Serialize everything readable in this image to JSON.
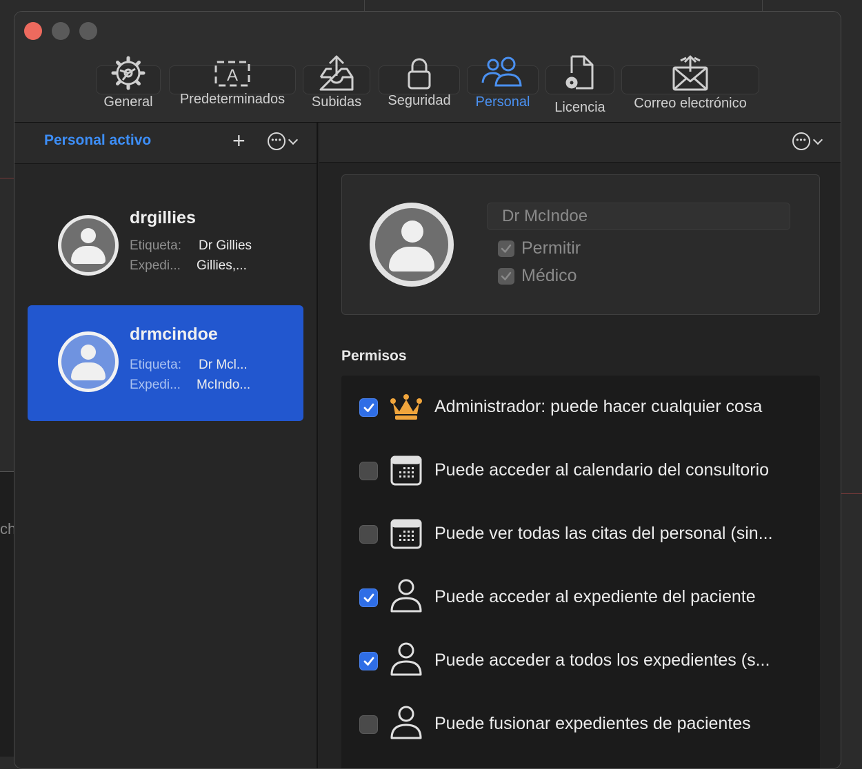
{
  "toolbar": {
    "items": [
      {
        "label": "General",
        "icon": "gear-icon"
      },
      {
        "label": "Predeterminados",
        "icon": "text-template-icon"
      },
      {
        "label": "Subidas",
        "icon": "upload-tray-icon"
      },
      {
        "label": "Seguridad",
        "icon": "lock-icon"
      },
      {
        "label": "Personal",
        "icon": "people-icon",
        "active": true
      },
      {
        "label": "Licencia",
        "icon": "document-gear-icon"
      },
      {
        "label": "Correo electrónico",
        "icon": "envelope-icon"
      }
    ]
  },
  "sidebar": {
    "title": "Personal activo",
    "add_label": "+",
    "users": [
      {
        "username": "drgillies",
        "tag_key": "Etiqueta:",
        "tag_value": "Dr Gillies",
        "record_key": "Expedi...",
        "record_value": "Gillies,..."
      },
      {
        "username": "drmcindoe",
        "tag_key": "Etiqueta:",
        "tag_value": "Dr Mcl...",
        "record_key": "Expedi...",
        "record_value": "McIndo...",
        "selected": true
      }
    ]
  },
  "detail": {
    "name_value": "Dr McIndoe",
    "allow_label": "Permitir",
    "doctor_label": "Médico"
  },
  "permissions": {
    "title": "Permisos",
    "items": [
      {
        "label": "Administrador: puede hacer cualquier cosa",
        "checked": true,
        "icon": "crown-icon"
      },
      {
        "label": "Puede acceder al calendario del consultorio",
        "checked": false,
        "icon": "calendar-icon"
      },
      {
        "label": "Puede ver todas las citas del personal (sin...",
        "checked": false,
        "icon": "calendar-icon"
      },
      {
        "label": "Puede acceder al expediente del paciente",
        "checked": true,
        "icon": "person-icon"
      },
      {
        "label": "Puede acceder a todos los expedientes (s...",
        "checked": true,
        "icon": "person-icon"
      },
      {
        "label": "Puede fusionar expedientes de pacientes",
        "checked": false,
        "icon": "person-icon"
      }
    ]
  },
  "colors": {
    "accent": "#3d8ef7",
    "selection": "#2257cf",
    "crown": "#f0a53c",
    "close": "#ed6a5e"
  }
}
